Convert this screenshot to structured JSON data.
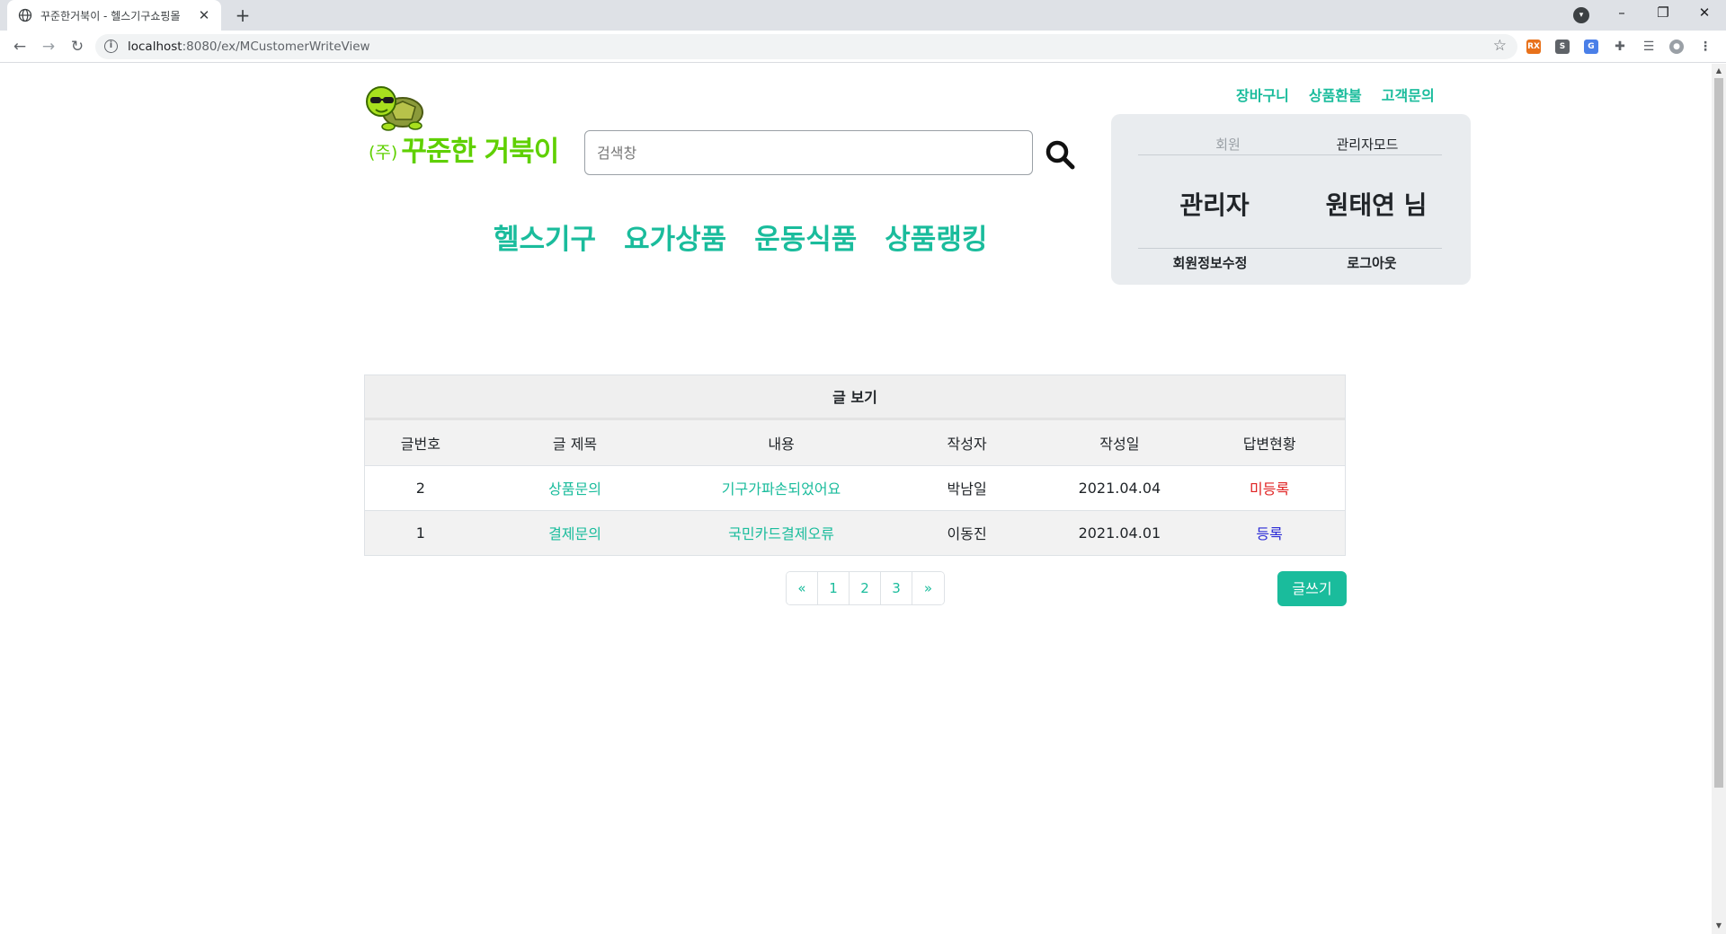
{
  "browser": {
    "tab_title": "꾸준한거북이 - 헬스기구쇼핑몰",
    "close_glyph": "✕",
    "newtab_glyph": "+",
    "url_host": "localhost",
    "url_path": ":8080/ex/MCustomerWriteView",
    "extensions": [
      {
        "label": "RX",
        "color": "#e8711a"
      },
      {
        "label": "S",
        "color": "#5f6368"
      },
      {
        "label": "G",
        "color": "#4a7fe8"
      }
    ]
  },
  "header": {
    "logo_corp": "(주)",
    "logo_name": "꾸준한 거북이",
    "search_placeholder": "검색창",
    "top_links": [
      "장바구니",
      "상품환불",
      "고객문의"
    ],
    "nav": [
      "헬스기구",
      "요가상품",
      "운동식품",
      "상품랭킹"
    ]
  },
  "user_box": {
    "tab_member": "회원",
    "tab_admin": "관리자모드",
    "role": "관리자",
    "user_name": "원태연 님",
    "edit_info": "회원정보수정",
    "logout": "로그아웃"
  },
  "board": {
    "caption": "글 보기",
    "columns": [
      "글번호",
      "글 제목",
      "내용",
      "작성자",
      "작성일",
      "답변현황"
    ],
    "rows": [
      {
        "no": "2",
        "title": "상품문의",
        "content": "기구가파손되었어요",
        "author": "박남일",
        "date": "2021.04.04",
        "status": "미등록",
        "status_color": "#e02424"
      },
      {
        "no": "1",
        "title": "결제문의",
        "content": "국민카드결제오류",
        "author": "이동진",
        "date": "2021.04.01",
        "status": "등록",
        "status_color": "#2b2bd6"
      }
    ]
  },
  "pager": {
    "prev": "«",
    "pages": [
      "1",
      "2",
      "3"
    ],
    "next": "»"
  },
  "write_button": "글쓰기",
  "colors": {
    "accent": "#1abc9c",
    "logo": "#5fd000"
  }
}
